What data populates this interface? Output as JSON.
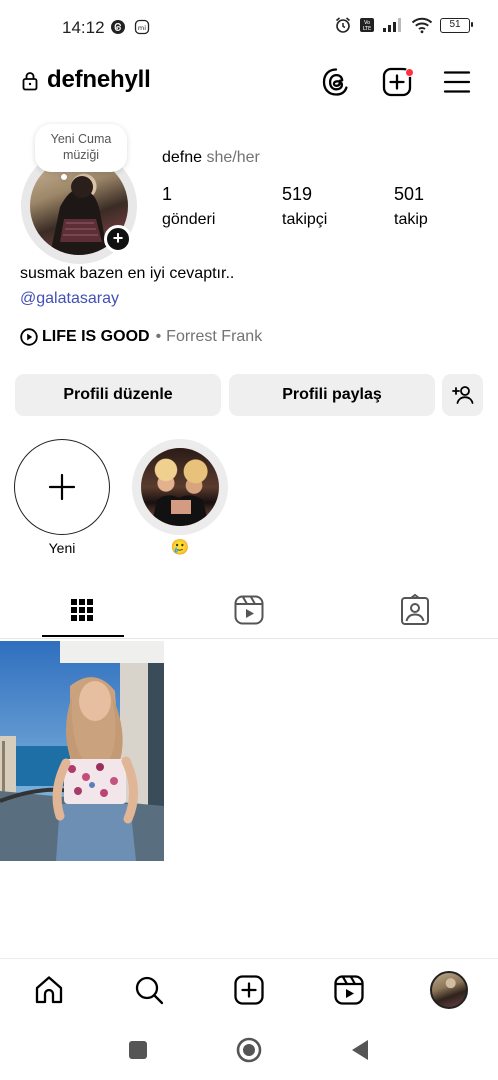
{
  "status_bar": {
    "time": "14:12",
    "battery": "51"
  },
  "header": {
    "username": "defnehyll"
  },
  "profile": {
    "note": "Yeni Cuma müziği",
    "display_name": "defne",
    "pronouns": "she/her",
    "stats": [
      {
        "value": "1",
        "label": "gönderi"
      },
      {
        "value": "519",
        "label": "takipçi"
      },
      {
        "value": "501",
        "label": "takip"
      }
    ],
    "bio": "susmak bazen en iyi cevaptır..",
    "bio_link": "@galatasaray",
    "music": {
      "song": "LIFE IS GOOD",
      "separator": "•",
      "artist": "Forrest Frank"
    }
  },
  "actions": {
    "edit_profile": "Profili düzenle",
    "share_profile": "Profili paylaş"
  },
  "highlights": [
    {
      "label": "Yeni"
    },
    {
      "label": "🥲"
    }
  ],
  "colors": {
    "link": "#4150b5",
    "notification": "#ff3040",
    "button_bg": "#efefef"
  }
}
